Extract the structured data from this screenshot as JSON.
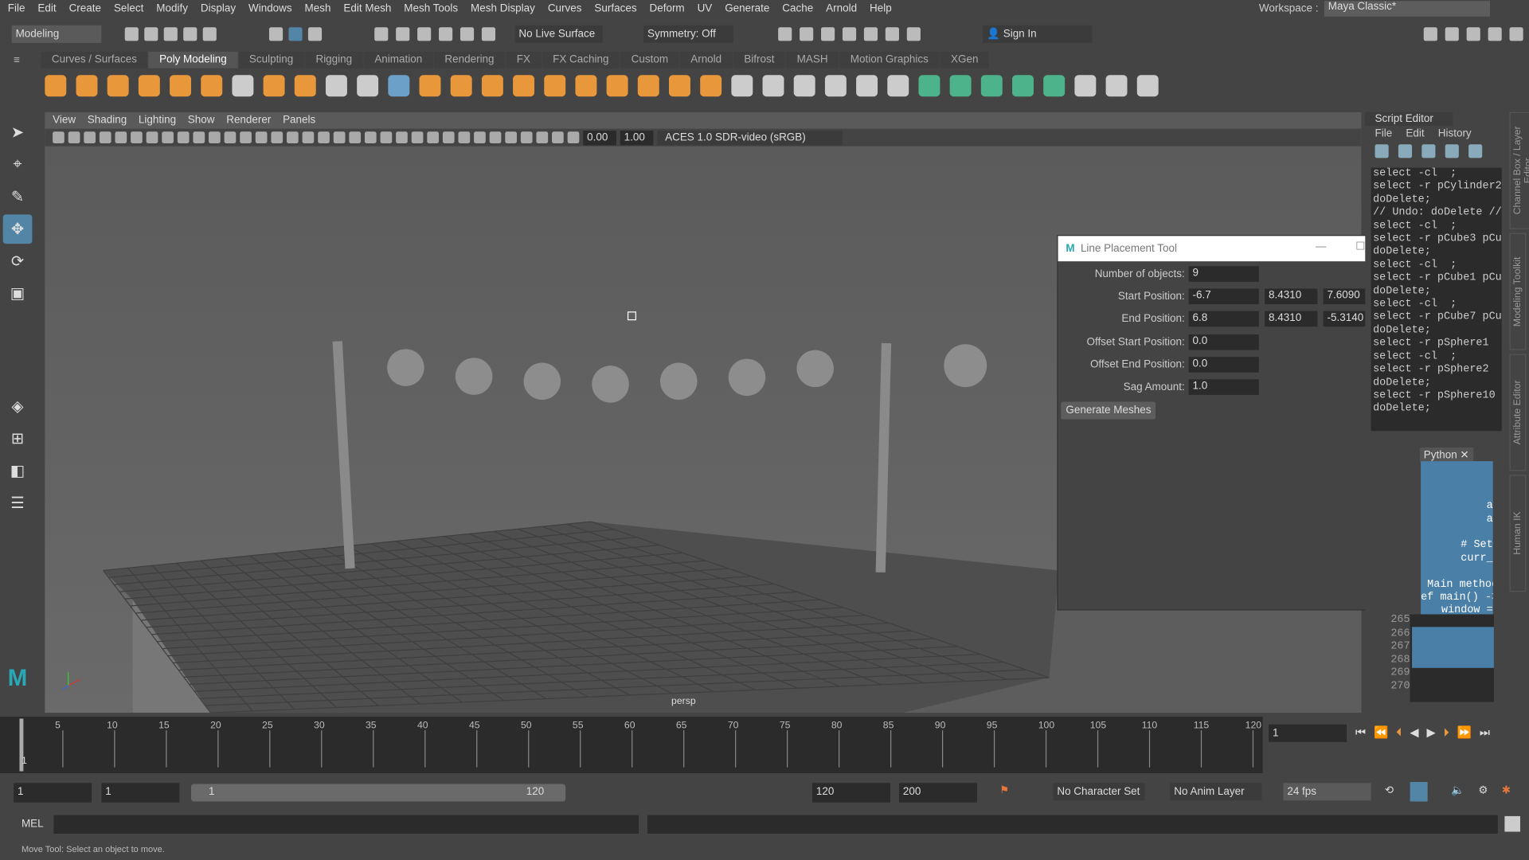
{
  "menu": [
    "File",
    "Edit",
    "Create",
    "Select",
    "Modify",
    "Display",
    "Windows",
    "Mesh",
    "Edit Mesh",
    "Mesh Tools",
    "Mesh Display",
    "Curves",
    "Surfaces",
    "Deform",
    "UV",
    "Generate",
    "Cache",
    "Arnold",
    "Help"
  ],
  "workspace": {
    "label": "Workspace :",
    "value": "Maya Classic*"
  },
  "toolbar": {
    "mode": "Modeling",
    "live_surface": "No Live Surface",
    "symmetry": "Symmetry: Off",
    "sign_in": "Sign In"
  },
  "shelf_tabs": [
    "Curves / Surfaces",
    "Poly Modeling",
    "Sculpting",
    "Rigging",
    "Animation",
    "Rendering",
    "FX",
    "FX Caching",
    "Custom",
    "Arnold",
    "Bifrost",
    "MASH",
    "Motion Graphics",
    "XGen"
  ],
  "shelf_active": "Poly Modeling",
  "viewport": {
    "menu": [
      "View",
      "Shading",
      "Lighting",
      "Show",
      "Renderer",
      "Panels"
    ],
    "exposure": "0.00",
    "gamma": "1.00",
    "color_space": "ACES 1.0 SDR-video (sRGB)",
    "camera": "persp"
  },
  "dialog": {
    "title": "Line Placement Tool",
    "fields": [
      {
        "label": "Number of objects:",
        "values": [
          "9"
        ]
      },
      {
        "label": "Start Position:",
        "values": [
          "-6.7",
          "8.4310",
          "7.6090"
        ]
      },
      {
        "label": "End Position:",
        "values": [
          "6.8",
          "8.4310",
          "-5.3140"
        ]
      },
      {
        "label": "Offset Start Position:",
        "values": [
          "0.0"
        ]
      },
      {
        "label": "Offset End Position:",
        "values": [
          "0.0"
        ]
      },
      {
        "label": "Sag Amount:",
        "values": [
          "1.0"
        ]
      }
    ],
    "button": "Generate Meshes"
  },
  "script_editor": {
    "title": "Script Editor",
    "menu": [
      "File",
      "Edit",
      "History"
    ],
    "history": "select -cl  ;\nselect -r pCylinder2\ndoDelete;\n// Undo: doDelete //\nselect -cl  ;\nselect -r pCube3 pCu\ndoDelete;\nselect -cl  ;\nselect -r pCube1 pCu\ndoDelete;\nselect -cl  ;\nselect -r pCube7 pCu\ndoDelete;\nselect -r pSphere1 \nselect -cl  ;\nselect -r pSphere2 \ndoDelete;\nselect -r pSphere10\ndoDelete;",
    "tab": "Python",
    "code": "\n\n\n        a\n        a\n\n   # Set\n   curr_\n\n Main method\nef main() ->\n   window =\n\n# RUN MAIN ==\nif __name__ =\n    main()\n\n",
    "line_numbers": [
      "265",
      "266",
      "267",
      "268",
      "269",
      "270"
    ]
  },
  "right_tabs": [
    "Channel Box / Layer Editor",
    "Modeling Toolkit",
    "Attribute Editor",
    "Human IK"
  ],
  "timeline": {
    "ticks": [
      "5",
      "10",
      "15",
      "20",
      "25",
      "30",
      "35",
      "40",
      "45",
      "50",
      "55",
      "60",
      "65",
      "70",
      "75",
      "80",
      "85",
      "90",
      "95",
      "100",
      "105",
      "110",
      "115",
      "120"
    ],
    "current_frame": "1",
    "frame_marker": "1"
  },
  "range": {
    "start": "1",
    "anim_start": "1",
    "slider_start": "1",
    "slider_end": "120",
    "end": "120",
    "anim_end": "200",
    "character_set": "No Character Set",
    "anim_layer": "No Anim Layer",
    "fps": "24 fps"
  },
  "command_line": {
    "lang": "MEL"
  },
  "status": "Move Tool: Select an object to move.",
  "colors": {
    "accent": "#5285a6",
    "selection": "#4a7fa8",
    "shelf_orange": "#e8983b",
    "shelf_green": "#4db38a"
  }
}
